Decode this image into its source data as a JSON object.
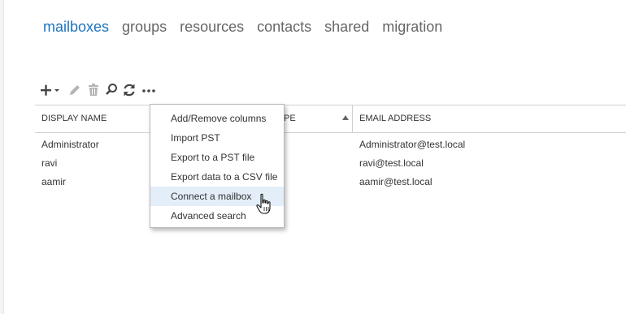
{
  "nav": {
    "tabs": [
      {
        "label": "mailboxes",
        "active": true
      },
      {
        "label": "groups",
        "active": false
      },
      {
        "label": "resources",
        "active": false
      },
      {
        "label": "contacts",
        "active": false
      },
      {
        "label": "shared",
        "active": false
      },
      {
        "label": "migration",
        "active": false
      }
    ]
  },
  "toolbar": {
    "buttons": [
      "add-icon",
      "edit-icon",
      "delete-icon",
      "search-icon",
      "refresh-icon",
      "more-icon"
    ]
  },
  "table": {
    "columns": {
      "display_name": "DISPLAY NAME",
      "type_partial": "PE",
      "email_address": "EMAIL ADDRESS"
    },
    "sort": "ascending",
    "rows": [
      {
        "display_name": "Administrator",
        "email": "Administrator@test.local"
      },
      {
        "display_name": "ravi",
        "email": "ravi@test.local"
      },
      {
        "display_name": "aamir",
        "email": "aamir@test.local"
      }
    ]
  },
  "menu": {
    "items": [
      {
        "label": "Add/Remove columns"
      },
      {
        "label": "Import PST"
      },
      {
        "label": "Export to a PST file"
      },
      {
        "label": "Export data to a CSV file"
      },
      {
        "label": "Connect a mailbox",
        "hover": true
      },
      {
        "label": "Advanced search"
      }
    ]
  },
  "colors": {
    "accent": "#1e73be",
    "hover_bg": "#e3eef8",
    "icon": "#444444",
    "icon_disabled": "#b5b5b5"
  }
}
